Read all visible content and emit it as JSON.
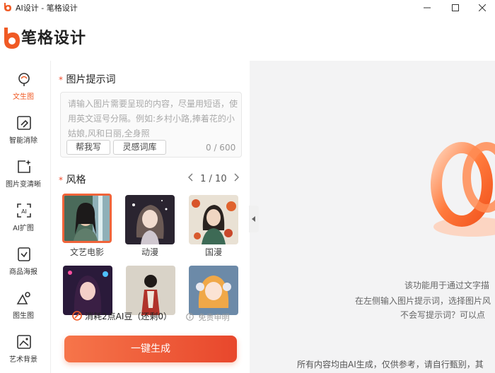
{
  "window": {
    "title": "AI设计 - 笔格设计",
    "controls": [
      "minimize",
      "maximize",
      "close"
    ]
  },
  "brand": {
    "logo_text": "笔格设计",
    "accent": "#f05a24"
  },
  "nav": {
    "items": [
      {
        "label": "文生图",
        "icon": "brain-bulb-icon",
        "active": true
      },
      {
        "label": "智能消除",
        "icon": "eraser-icon",
        "active": false
      },
      {
        "label": "图片变清晰",
        "icon": "sparkle-image-icon",
        "active": false
      },
      {
        "label": "AI扩图",
        "icon": "ai-expand-icon",
        "active": false
      },
      {
        "label": "商品海报",
        "icon": "poster-icon",
        "active": false
      },
      {
        "label": "图生图",
        "icon": "image-to-image-icon",
        "active": false
      },
      {
        "label": "艺术背景",
        "icon": "art-background-icon",
        "active": false
      }
    ]
  },
  "prompt": {
    "required_mark": "*",
    "title": "图片提示词",
    "placeholder": "请输入图片需要呈现的内容，尽量用短语，使用英文逗号分隔。例如:乡村小路,捧着花的小姑娘,风和日丽,全身照",
    "value": "",
    "help_button": "帮我写",
    "library_button": "灵感词库",
    "counter": "0 / 600"
  },
  "style": {
    "required_mark": "*",
    "title": "风格",
    "page": "1 / 10",
    "items": [
      {
        "label": "文艺电影",
        "selected": true
      },
      {
        "label": "动漫",
        "selected": false
      },
      {
        "label": "国漫",
        "selected": false
      },
      {
        "label": "",
        "selected": false
      },
      {
        "label": "",
        "selected": false
      },
      {
        "label": "",
        "selected": false
      }
    ]
  },
  "cost": {
    "text": "消耗2点AI豆（还剩0）",
    "disclaimer_link": "免责申明"
  },
  "generate_button": "一键生成",
  "preview": {
    "hint_line1": "该功能用于通过文字描",
    "hint_line2": "在左侧输入图片提示词，选择图片风",
    "hint_line3": "不会写提示词？可以点",
    "footer": "所有内容均由AI生成，仅供参考，请自行甄别，其"
  }
}
